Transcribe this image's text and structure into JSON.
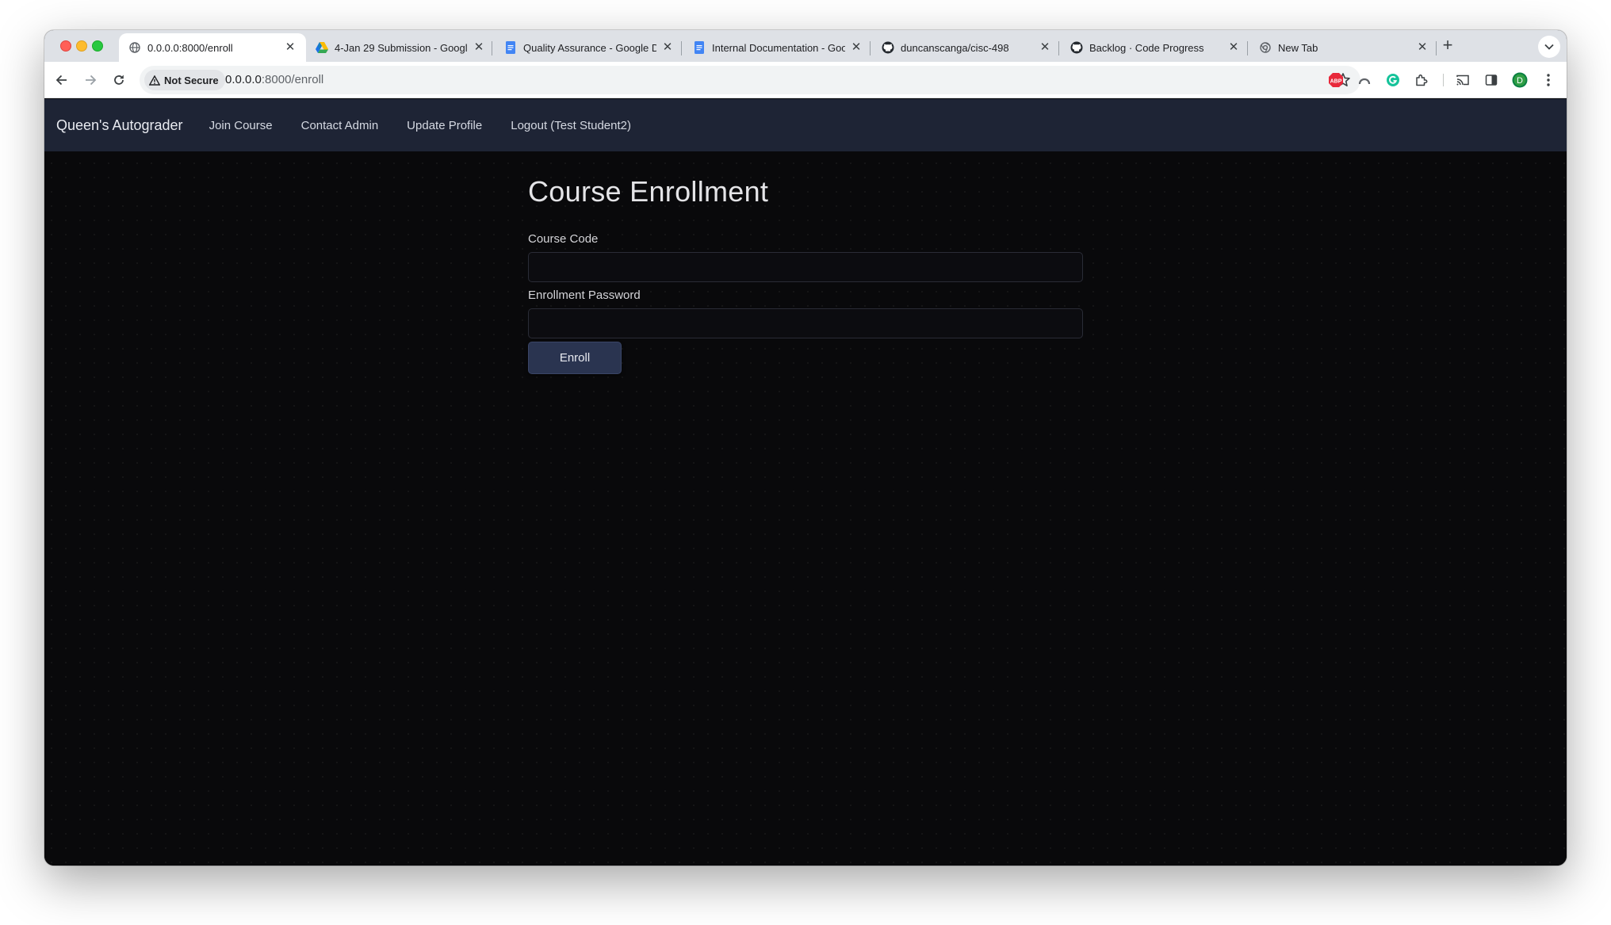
{
  "browser": {
    "tabs": [
      {
        "title": "0.0.0.0:8000/enroll",
        "icon": "globe-icon",
        "active": true
      },
      {
        "title": "4-Jan 29 Submission - Googl",
        "icon": "google-drive-icon",
        "active": false
      },
      {
        "title": "Quality Assurance - Google D",
        "icon": "google-docs-icon",
        "active": false
      },
      {
        "title": "Internal Documentation - Goo",
        "icon": "google-docs-icon",
        "active": false
      },
      {
        "title": "duncanscanga/cisc-498",
        "icon": "github-icon",
        "active": false
      },
      {
        "title": "Backlog · Code Progress",
        "icon": "github-icon",
        "active": false
      },
      {
        "title": "New Tab",
        "icon": "chrome-icon",
        "active": false
      }
    ],
    "security_label": "Not Secure",
    "url_host": "0.0.0.0",
    "url_path": ":8000/enroll",
    "profile_initial": "D",
    "abp_label": "ABP"
  },
  "navbar": {
    "brand": "Queen's Autograder",
    "links": [
      "Join Course",
      "Contact Admin",
      "Update Profile",
      "Logout (Test Student2)"
    ]
  },
  "form": {
    "title": "Course Enrollment",
    "course_code_label": "Course Code",
    "course_code_value": "",
    "password_label": "Enrollment Password",
    "password_value": "",
    "submit_label": "Enroll"
  },
  "colors": {
    "navbar_bg": "#1e2435",
    "page_bg": "#09090b",
    "button_bg": "#2a3450"
  }
}
